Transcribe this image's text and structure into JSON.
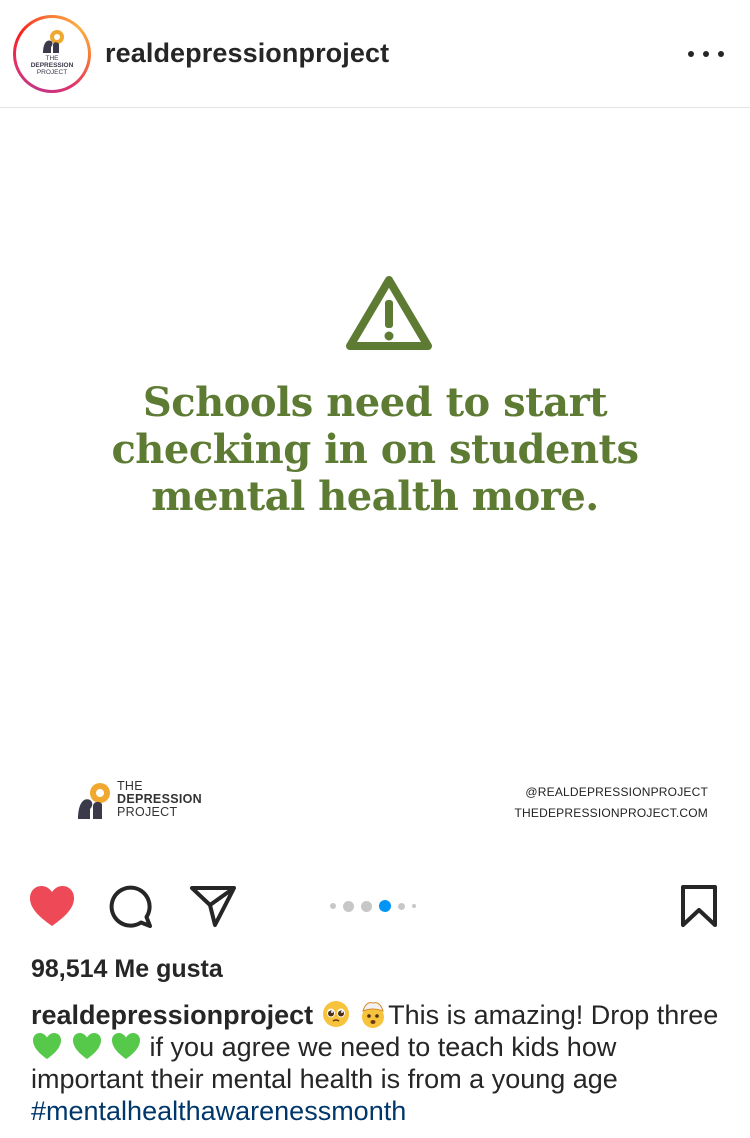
{
  "header": {
    "username": "realdepressionproject",
    "avatar": {
      "line1": "THE",
      "line2": "DEPRESSION",
      "line3": "PROJECT"
    },
    "more_icon": "ellipsis-icon"
  },
  "post": {
    "headline": "Schools need to start checking in on students mental health more.",
    "warning_icon": "warning-triangle-icon",
    "footer_logo": {
      "line1": "THE",
      "line2": "DEPRESSION",
      "line3": "PROJECT"
    },
    "footer_handle": "@REALDEPRESSIONPROJECT",
    "footer_site": "THEDEPRESSIONPROJECT.COM",
    "colors": {
      "headline": "#5d7b33",
      "heart": "#ed4956",
      "active_dot": "#0095f6",
      "hashtag": "#00376b"
    }
  },
  "actions": {
    "like_icon": "heart-icon",
    "comment_icon": "comment-icon",
    "share_icon": "send-icon",
    "save_icon": "bookmark-icon",
    "carousel": {
      "total_dots": 6,
      "active_index": 3
    }
  },
  "likes": {
    "text": "98,514 Me gusta"
  },
  "caption": {
    "username": "realdepressionproject",
    "part1": "This is amazing! Drop three",
    "part2": "if you agree we need to teach kids how important their mental health is from a young age",
    "hashtag": "#mentalhealthawarenessmonth",
    "emojis": [
      "pleading-face-emoji",
      "exploding-head-emoji",
      "green-heart-emoji",
      "green-heart-emoji",
      "green-heart-emoji"
    ]
  }
}
